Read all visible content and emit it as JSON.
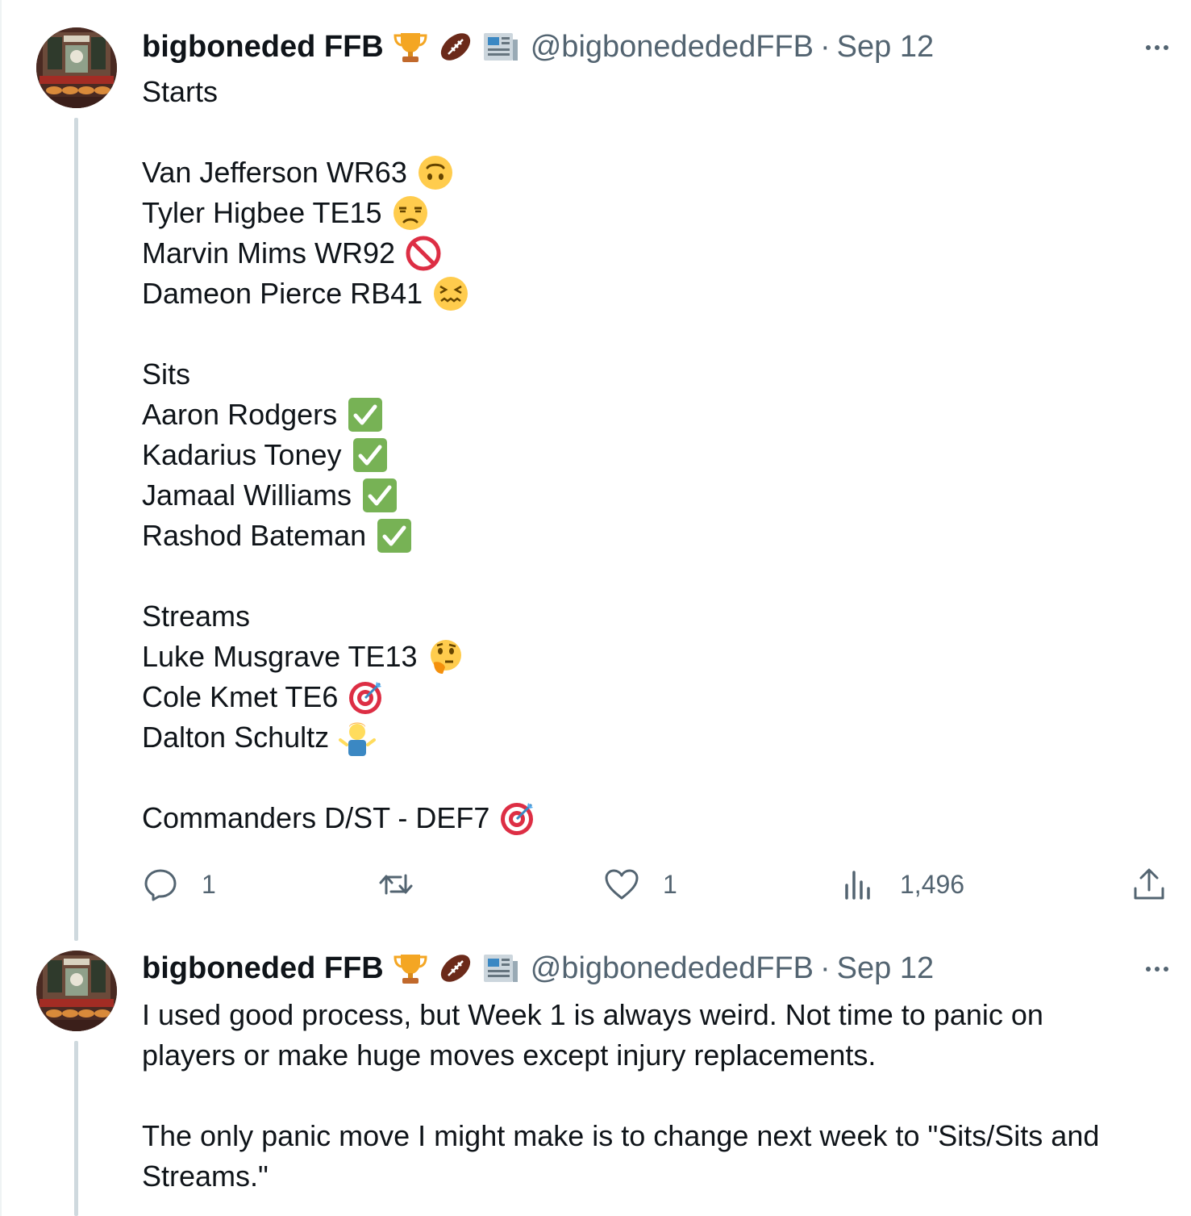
{
  "tweets": [
    {
      "author": {
        "display_name": "bigboneded FFB",
        "handle": "@bigbonedededFFB",
        "date": "Sep 12"
      },
      "badges": [
        "trophy-icon",
        "football-icon",
        "newspaper-icon"
      ],
      "lines": [
        {
          "text": "Starts",
          "emoji": ""
        },
        {
          "text": "",
          "emoji": ""
        },
        {
          "text": "Van Jefferson WR63",
          "emoji": "upside-down-face"
        },
        {
          "text": "Tyler Higbee TE15",
          "emoji": "unamused-face"
        },
        {
          "text": "Marvin Mims WR92",
          "emoji": "prohibited"
        },
        {
          "text": "Dameon Pierce RB41",
          "emoji": "confounded-face"
        },
        {
          "text": "",
          "emoji": ""
        },
        {
          "text": "Sits",
          "emoji": ""
        },
        {
          "text": "Aaron Rodgers",
          "emoji": "check-mark-button"
        },
        {
          "text": "Kadarius Toney",
          "emoji": "check-mark-button"
        },
        {
          "text": "Jamaal Williams",
          "emoji": "check-mark-button"
        },
        {
          "text": "Rashod Bateman",
          "emoji": "check-mark-button"
        },
        {
          "text": "",
          "emoji": ""
        },
        {
          "text": "Streams",
          "emoji": ""
        },
        {
          "text": "Luke Musgrave TE13",
          "emoji": "thinking-face"
        },
        {
          "text": "Cole Kmet TE6",
          "emoji": "direct-hit"
        },
        {
          "text": "Dalton Schultz",
          "emoji": "person-shrugging"
        },
        {
          "text": "",
          "emoji": ""
        },
        {
          "text": "Commanders D/ST - DEF7",
          "emoji": "direct-hit"
        }
      ],
      "actions": {
        "replies": "1",
        "reposts": "",
        "likes": "1",
        "views": "1,496"
      }
    },
    {
      "author": {
        "display_name": "bigboneded FFB",
        "handle": "@bigbonedededFFB",
        "date": "Sep 12"
      },
      "badges": [
        "trophy-icon",
        "football-icon",
        "newspaper-icon"
      ],
      "lines": [
        {
          "text": "I used good process, but Week 1 is always weird. Not time to panic on",
          "emoji": ""
        },
        {
          "text": "players or make huge moves except injury replacements.",
          "emoji": ""
        },
        {
          "text": "",
          "emoji": ""
        },
        {
          "text": "The only panic move I might make is to change next week to \"Sits/Sits and",
          "emoji": ""
        },
        {
          "text": "Streams.\"",
          "emoji": ""
        }
      ]
    }
  ],
  "colors": {
    "text": "#0f1419",
    "muted": "#536471",
    "thread_line": "#cfd9de"
  },
  "separator": "·"
}
